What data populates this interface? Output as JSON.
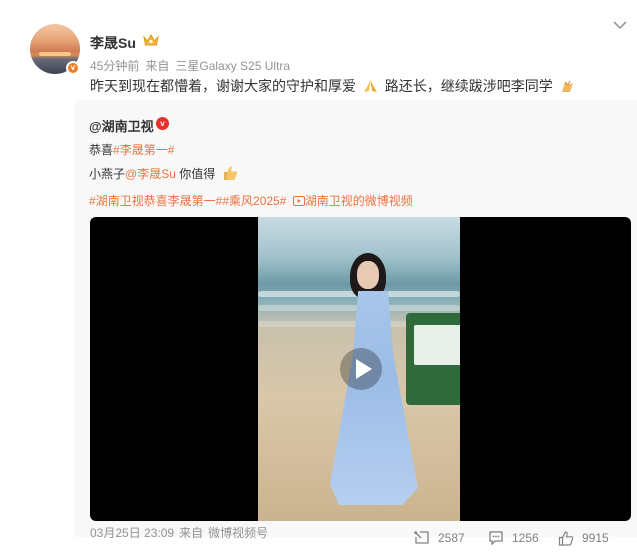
{
  "post": {
    "username": "李晟Su",
    "time": "45分钟前",
    "source_prefix": "来自",
    "source_device": "三星Galaxy S25 Ultra",
    "text_part1": "昨天到现在都懵着，谢谢大家的守护和厚爱",
    "text_part2": "路还长，继续跋涉吧李同学",
    "icons": {
      "avatar": "sunset-avatar",
      "verified": "orange-v-badge",
      "crown": "crown-icon",
      "menu": "chevron-down-icon",
      "pray_emoji": "pray-emoji-icon",
      "clap_emoji": "clap-emoji-icon"
    }
  },
  "repost": {
    "username": "@湖南卫视",
    "line1_prefix": "恭喜",
    "line1_tag": "#李晟第一#",
    "line2_prefix": "小燕子",
    "line2_mention": "@李晟Su",
    "line2_suffix": "你值得",
    "line3_tags": "#湖南卫视恭喜李晟第一##乘风2025#",
    "line3_video_link": "湖南卫视的微博视频",
    "footer_date": "03月25日 23:09",
    "footer_source_prefix": "来自",
    "footer_source": "微博视频号",
    "reposts": "2587",
    "comments": "1256",
    "likes": "9915",
    "link_color": "#eb7340"
  }
}
